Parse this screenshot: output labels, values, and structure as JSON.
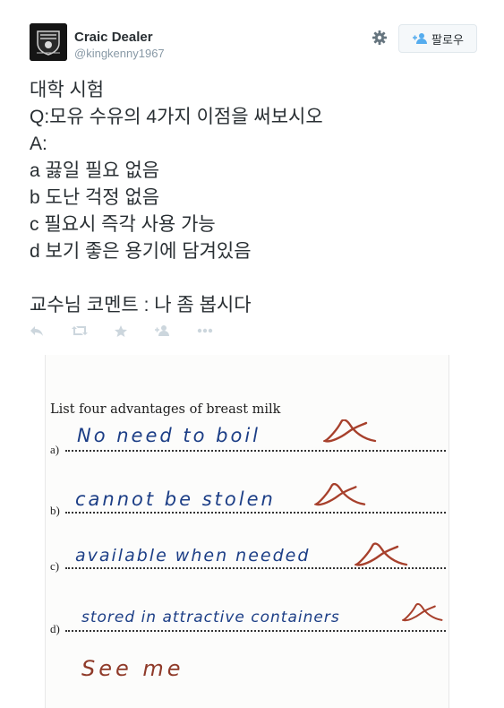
{
  "profile": {
    "display_name": "Craic Dealer",
    "handle": "@kingkenny1967",
    "follow_label": "팔로우"
  },
  "tweet_lines": [
    "대학 시험",
    "Q:모유 수유의 4가지 이점을 써보시오",
    "A:",
    "a 끓일 필요 없음",
    "b 도난 걱정 없음",
    "c 필요시 즉각 사용 가능",
    "d 보기 좋은 용기에 담겨있음",
    "",
    "교수님 코멘트 : 나 좀 봅시다"
  ],
  "actions": [
    "reply-icon",
    "retweet-icon",
    "favorite-icon",
    "follow-icon",
    "more-icon"
  ],
  "photo": {
    "question": "List four advantages of breast milk",
    "answers": [
      {
        "label": "a)",
        "text": "No need to boil"
      },
      {
        "label": "b)",
        "text": "cannot be stolen"
      },
      {
        "label": "c)",
        "text": "available when needed"
      },
      {
        "label": "d)",
        "text": "stored in attractive containers"
      }
    ],
    "comment": "See me",
    "colors": {
      "ink": "#1c3e86",
      "marker": "#a7402c",
      "comment": "#8f3a29"
    }
  }
}
